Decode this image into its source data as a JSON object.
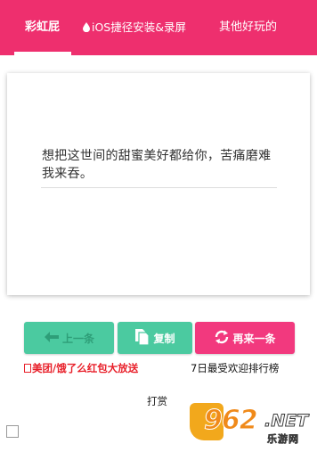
{
  "tabs": {
    "tab1": "彩虹屁",
    "tab2": "iOS捷径安装&录屏",
    "tab3": "其他好玩的"
  },
  "quote": {
    "text": "想把这世间的甜蜜美好都给你，苦痛磨难我来吞。"
  },
  "buttons": {
    "prev": "上一条",
    "copy": "复制",
    "next": "再来一条"
  },
  "links": {
    "promo": "美团/饿了么红包大放送",
    "ranking": "7日最受欢迎排行榜",
    "reward": "打赏"
  },
  "watermark": {
    "number": "962",
    "domain": ".NET",
    "subtitle": "乐游网"
  },
  "colors": {
    "header": "#ee2f6e",
    "green": "#4bcaa0",
    "pink": "#f2397e",
    "promo": "#e8202a"
  },
  "icons": {
    "tab2": "drop-icon",
    "prev": "arrow-left-icon",
    "copy": "copy-icon",
    "next": "refresh-icon"
  }
}
